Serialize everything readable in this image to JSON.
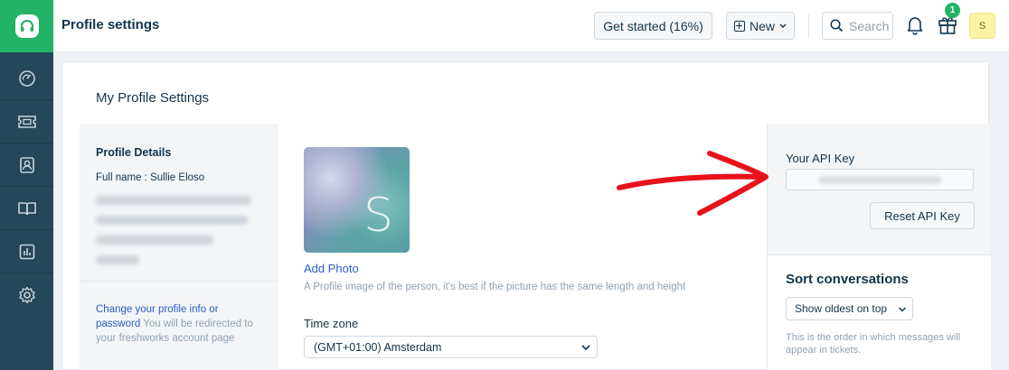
{
  "header": {
    "title": "Profile settings",
    "get_started": "Get started (16%)",
    "new_label": "New",
    "search_placeholder": "Search",
    "gift_badge": "1",
    "avatar_initial": "S"
  },
  "main": {
    "card_title": "My Profile Settings",
    "profile_details": {
      "title": "Profile Details",
      "full_name": "Full name : Sullie Eloso",
      "change_link": "Change your profile info or password",
      "change_note": " You will be redirected to your freshworks account page"
    },
    "photo": {
      "letter": "S",
      "add_label": "Add Photo",
      "hint": "A Profile image of the person, it's best if the picture has the same length and height"
    },
    "timezone": {
      "label": "Time zone",
      "value": "(GMT+01:00) Amsterdam"
    },
    "api": {
      "title": "Your API Key",
      "reset_label": "Reset API Key"
    },
    "sort": {
      "title": "Sort conversations",
      "value": "Show oldest on top",
      "hint": "This is the order in which messages will appear in tickets."
    }
  },
  "colors": {
    "brand_green": "#22b366",
    "sidebar": "#264659",
    "link_blue": "#2c5cc5",
    "annotation_red": "#e8121b"
  },
  "sidebar": {
    "icons": [
      "headset-icon",
      "dashboard-icon",
      "tickets-icon",
      "contacts-icon",
      "knowledge-base-icon",
      "reports-icon",
      "settings-icon"
    ]
  }
}
